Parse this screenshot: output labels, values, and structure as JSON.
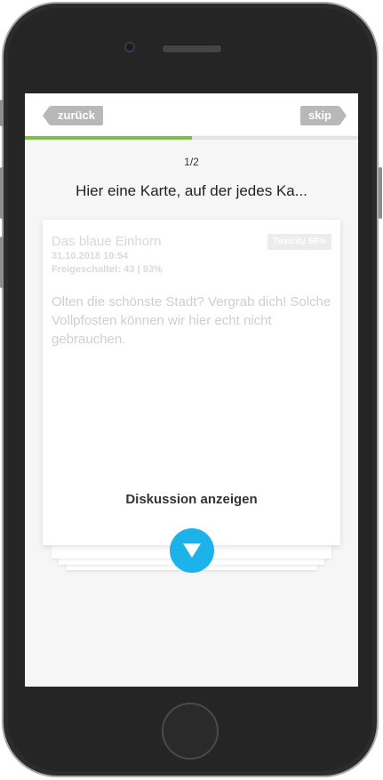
{
  "nav": {
    "back_label": "zurück",
    "skip_label": "skip"
  },
  "progress": {
    "fraction": 0.5,
    "counter": "1/2",
    "fill_color": "#7bc043"
  },
  "headline": "Hier eine Karte, auf der jedes Ka...",
  "card": {
    "author": "Das blaue Einhorn",
    "date": "31.10.2018  10:54",
    "unlocked": "Freigeschaltet: 43 | 93%",
    "toxicity": "Toxicity 56%",
    "text": "Olten die schönste Stadt? Vergrab dich! Solche Vollpfosten können wir hier echt nicht gebrauchen.",
    "discussion_label": "Diskussion anzeigen"
  },
  "icons": {
    "expand": "chevron-down-icon",
    "accent": "#1bb3ea"
  }
}
